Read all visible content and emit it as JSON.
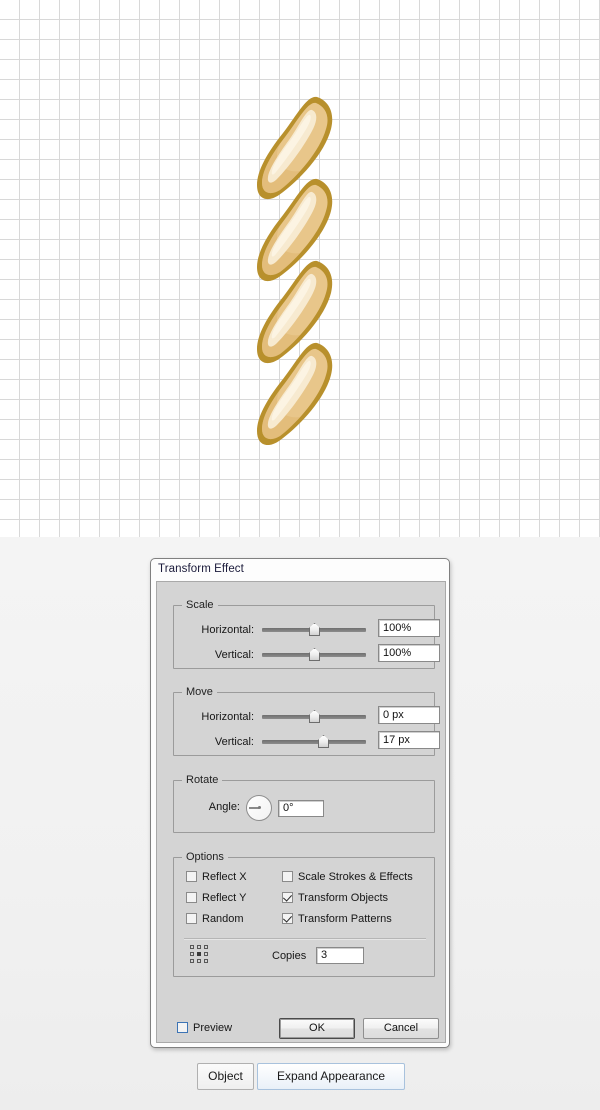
{
  "canvas": {
    "grid_size_px": 20,
    "grid_line_color": "#d8d8d8",
    "background_color": "#ffffff",
    "artwork": {
      "name": "twisted-rope-breadstick",
      "segments": 4,
      "outline_color": "#b8902c",
      "fill_color": "#e8c68a",
      "highlight_color": "#f7ead0",
      "shadow_color": "#cda352"
    }
  },
  "dialog": {
    "title": "Transform Effect",
    "scale": {
      "legend": "Scale",
      "horizontal": {
        "label": "Horizontal:",
        "value": "100%",
        "slider_percent": 50
      },
      "vertical": {
        "label": "Vertical:",
        "value": "100%",
        "slider_percent": 50
      }
    },
    "move": {
      "legend": "Move",
      "horizontal": {
        "label": "Horizontal:",
        "value": "0 px",
        "slider_percent": 50
      },
      "vertical": {
        "label": "Vertical:",
        "value": "17 px",
        "slider_percent": 58
      }
    },
    "rotate": {
      "legend": "Rotate",
      "angle_label": "Angle:",
      "angle_value": "0°"
    },
    "options": {
      "legend": "Options",
      "checkboxes": [
        {
          "label": "Reflect X",
          "checked": false
        },
        {
          "label": "Reflect Y",
          "checked": false
        },
        {
          "label": "Random",
          "checked": false
        },
        {
          "label": "Scale Strokes & Effects",
          "checked": false
        },
        {
          "label": "Transform Objects",
          "checked": true
        },
        {
          "label": "Transform Patterns",
          "checked": true
        }
      ],
      "anchor_icon": "anchor-point-grid-icon",
      "copies_label": "Copies",
      "copies_value": "3"
    },
    "footer": {
      "preview_label": "Preview",
      "preview_checked": false,
      "ok_label": "OK",
      "cancel_label": "Cancel"
    },
    "accent_color": "#3c74b5"
  },
  "toolbar": {
    "object_label": "Object",
    "expand_label": "Expand Appearance",
    "highlight_color": "#a8c2dd"
  }
}
